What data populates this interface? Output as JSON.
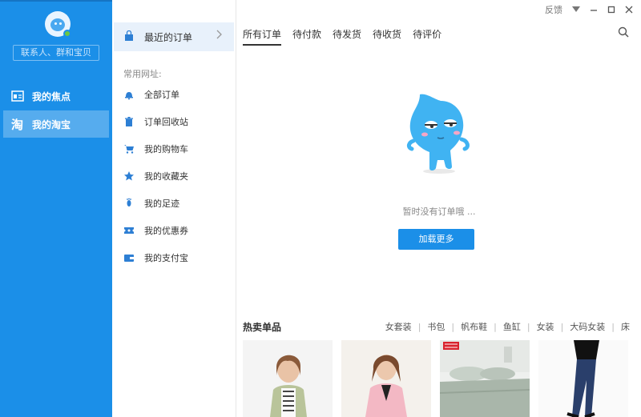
{
  "sidebar": {
    "search_placeholder": "联系人、群和宝贝",
    "items": [
      {
        "label": "我的焦点"
      },
      {
        "label": "我的淘宝"
      }
    ]
  },
  "menu": {
    "recent_orders": "最近的订单",
    "section_title": "常用网址:",
    "items": [
      {
        "label": "全部订单"
      },
      {
        "label": "订单回收站"
      },
      {
        "label": "我的购物车"
      },
      {
        "label": "我的收藏夹"
      },
      {
        "label": "我的足迹"
      },
      {
        "label": "我的优惠券"
      },
      {
        "label": "我的支付宝"
      }
    ]
  },
  "window": {
    "feedback": "反馈"
  },
  "tabs": [
    {
      "label": "所有订单"
    },
    {
      "label": "待付款"
    },
    {
      "label": "待发货"
    },
    {
      "label": "待收货"
    },
    {
      "label": "待评价"
    }
  ],
  "empty": {
    "message": "暂时没有订单哦 ...",
    "button": "加载更多"
  },
  "hot": {
    "title": "热卖单品",
    "categories": [
      "女套装",
      "书包",
      "帆布鞋",
      "鱼缸",
      "女装",
      "大码女装",
      "床"
    ]
  },
  "colors": {
    "brand_blue": "#1b8fe8",
    "active_nav": "#56acee"
  }
}
